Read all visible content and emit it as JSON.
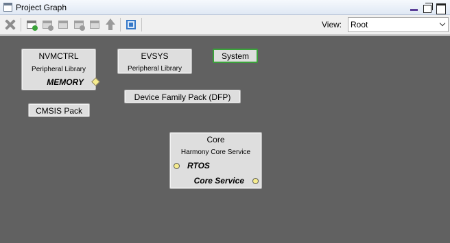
{
  "window": {
    "title": "Project Graph"
  },
  "toolbar": {
    "view_label": "View:",
    "view_value": "Root"
  },
  "nodes": {
    "nvmctrl": {
      "name": "NVMCTRL",
      "subtitle": "Peripheral Library",
      "capability": "MEMORY"
    },
    "evsys": {
      "name": "EVSYS",
      "subtitle": "Peripheral Library"
    },
    "system": {
      "name": "System"
    },
    "dfp": {
      "name": "Device Family Pack (DFP)"
    },
    "cmsis": {
      "name": "CMSIS Pack"
    },
    "core": {
      "name": "Core",
      "subtitle": "Harmony Core Service",
      "capability_1": "RTOS",
      "capability_2": "Core Service"
    }
  },
  "colors": {
    "canvas": "#616161",
    "node_fill": "#dedede",
    "selected_border": "#3aa23a",
    "connector": "#f6ec8e"
  }
}
